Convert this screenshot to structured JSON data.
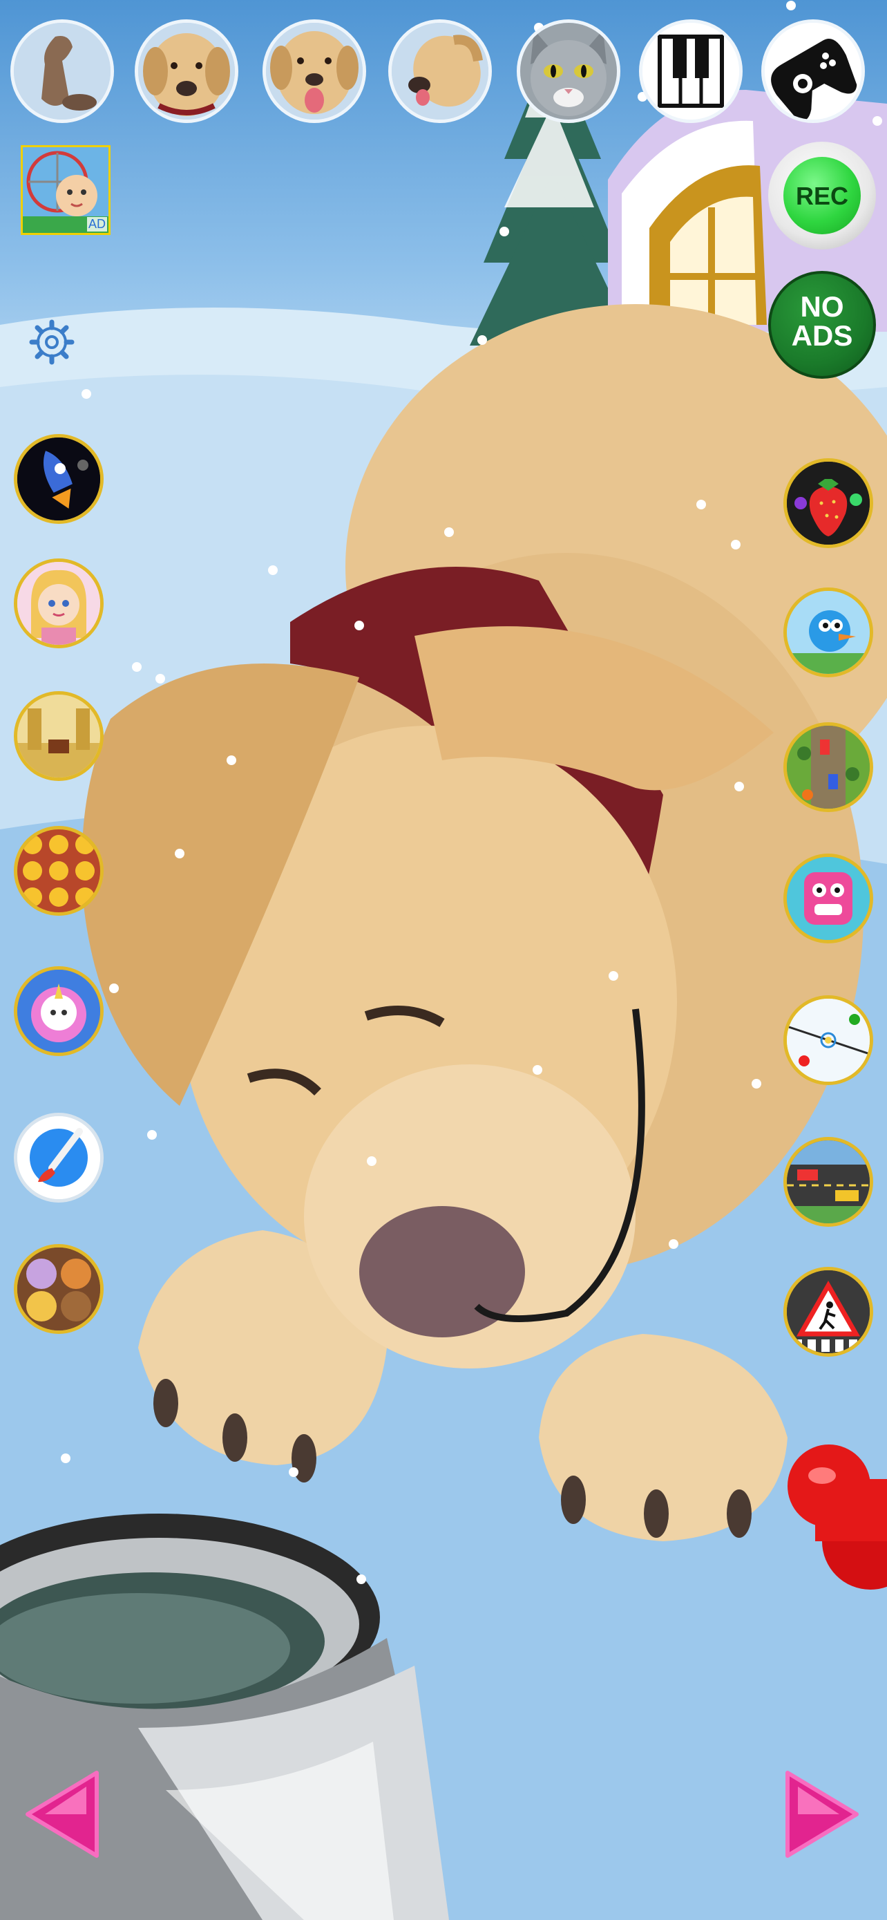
{
  "top_bar": {
    "buttons": [
      {
        "id": "dog-sit",
        "icon": "sitting-dog-icon"
      },
      {
        "id": "dog-face-1",
        "icon": "dog-face-icon"
      },
      {
        "id": "dog-face-2",
        "icon": "dog-face-tongue-icon"
      },
      {
        "id": "dog-face-3",
        "icon": "dog-head-tilt-icon"
      },
      {
        "id": "cat-face",
        "icon": "cat-face-icon"
      },
      {
        "id": "piano",
        "icon": "piano-keys-icon"
      },
      {
        "id": "gamepad",
        "icon": "gamepad-icon"
      }
    ]
  },
  "ad_badge": {
    "label": "AD"
  },
  "record_button": {
    "label": "REC"
  },
  "no_ads_button": {
    "line1": "NO",
    "line2": "ADS"
  },
  "settings": {
    "icon": "gear-icon"
  },
  "left_games": [
    "rocket-game",
    "princess-game",
    "maze-game",
    "emoji-match-game",
    "unicorn-game",
    "paint-app",
    "cartoon-faces-game"
  ],
  "right_games": [
    "fruit-game",
    "bird-game",
    "road-runner-game",
    "pink-monster-game",
    "air-hockey-game",
    "traffic-game",
    "crosswalk-game"
  ],
  "nav": {
    "prev": "left-arrow-icon",
    "next": "right-arrow-icon"
  },
  "colors": {
    "rec_green": "#2fd640",
    "no_ads_green": "#1a7a2a",
    "arrow_pink": "#e2248f",
    "frame_gold": "#e2b928"
  }
}
